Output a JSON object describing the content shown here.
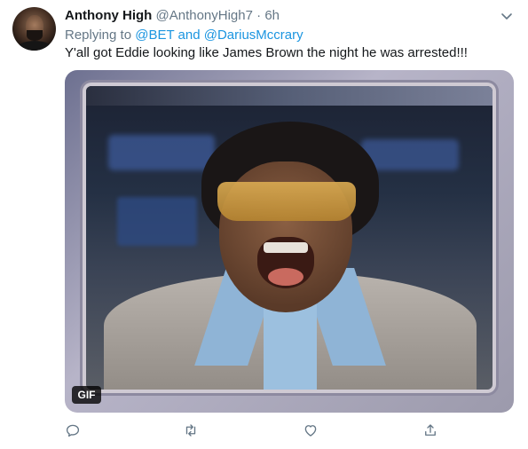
{
  "tweet": {
    "name": "Anthony High",
    "handle": "@AnthonyHigh7",
    "separator": "·",
    "time": "6h",
    "replying_prefix": "Replying to",
    "mention_1": "@BET",
    "mention_joiner": "and",
    "mention_2": "@DariusMccrary",
    "text": "Y'all got Eddie looking like James Brown the night he was arrested!!!",
    "media_badge": "GIF"
  },
  "icons": {
    "menu": "chevron-down-icon",
    "reply": "reply-icon",
    "retweet": "retweet-icon",
    "like": "heart-icon",
    "share": "share-icon"
  },
  "colors": {
    "link": "#1b95e0",
    "secondary_text": "#657786",
    "primary_text": "#14171a"
  }
}
